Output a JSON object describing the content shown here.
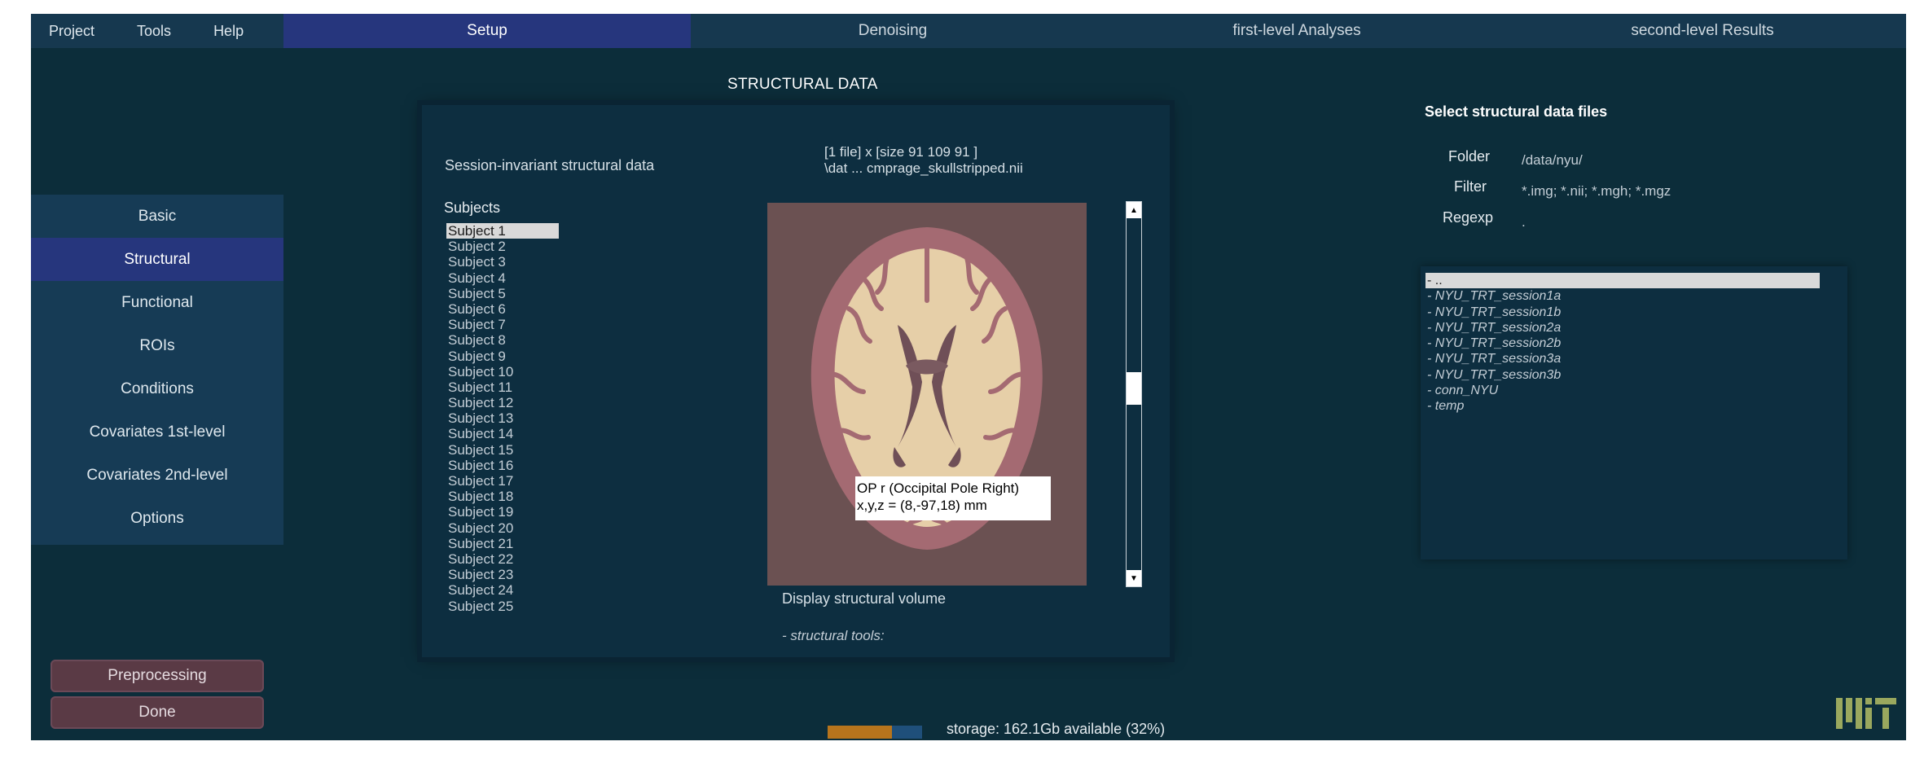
{
  "menu": [
    "Project",
    "Tools",
    "Help"
  ],
  "tabs": [
    {
      "label": "Setup",
      "active": true
    },
    {
      "label": "Denoising",
      "active": false
    },
    {
      "label": "first-level Analyses",
      "active": false
    },
    {
      "label": "second-level Results",
      "active": false
    }
  ],
  "sidebar": {
    "items": [
      {
        "label": "Basic",
        "active": false
      },
      {
        "label": "Structural",
        "active": true
      },
      {
        "label": "Functional",
        "active": false
      },
      {
        "label": "ROIs",
        "active": false
      },
      {
        "label": "Conditions",
        "active": false
      },
      {
        "label": "Covariates 1st-level",
        "active": false
      },
      {
        "label": "Covariates 2nd-level",
        "active": false
      },
      {
        "label": "Options",
        "active": false
      }
    ],
    "preprocessing_label": "Preprocessing",
    "done_label": "Done"
  },
  "center": {
    "title": "STRUCTURAL DATA",
    "session_label": "Session-invariant structural data",
    "subjects_label": "Subjects",
    "subjects": [
      "Subject 1",
      "Subject 2",
      "Subject 3",
      "Subject 4",
      "Subject 5",
      "Subject 6",
      "Subject 7",
      "Subject 8",
      "Subject 9",
      "Subject 10",
      "Subject 11",
      "Subject 12",
      "Subject 13",
      "Subject 14",
      "Subject 15",
      "Subject 16",
      "Subject 17",
      "Subject 18",
      "Subject 19",
      "Subject 20",
      "Subject 21",
      "Subject 22",
      "Subject 23",
      "Subject 24",
      "Subject 25"
    ],
    "selected_subject": 0,
    "file_info_line1": "[1 file] x [size 91 109 91 ]",
    "file_info_line2": "\\dat ... cmprage_skullstripped.nii",
    "tooltip_line1": "OP r (Occipital Pole Right)",
    "tooltip_line2": "x,y,z = (8,-97,18) mm",
    "display_label": "Display structural volume",
    "tools_label": "- structural tools:",
    "scroll_position": 0.48
  },
  "right": {
    "title": "Select structural data files",
    "folder_label": "Folder",
    "folder_value": "/data/nyu/",
    "filter_label": "Filter",
    "filter_value": "*.img; *.nii; *.mgh; *.mgz",
    "regexp_label": "Regexp",
    "regexp_value": ".",
    "files": [
      "- ..",
      "- NYU_TRT_session1a",
      "- NYU_TRT_session1b",
      "- NYU_TRT_session2a",
      "- NYU_TRT_session2b",
      "- NYU_TRT_session3a",
      "- NYU_TRT_session3b",
      "- conn_NYU",
      "- temp"
    ],
    "selected_file": 0
  },
  "storage": {
    "text": "storage: 162.1Gb available (32%)",
    "used_fraction": 0.68
  },
  "colors": {
    "background": "#0c2d3a",
    "menubar": "#16384f",
    "accent_active": "#26367d",
    "button_bg": "#5a3a45",
    "storage_used": "#b7741c",
    "storage_free": "#1f4f7a"
  }
}
